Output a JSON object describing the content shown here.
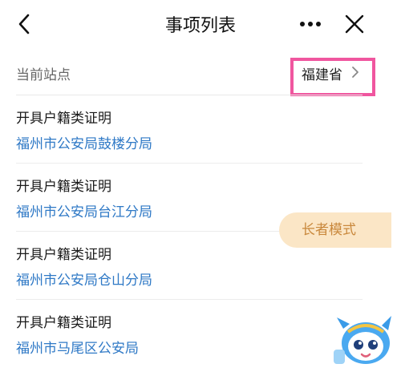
{
  "header": {
    "title": "事项列表"
  },
  "station": {
    "label": "当前站点",
    "value": "福建省"
  },
  "items": [
    {
      "title": "开具户籍类证明",
      "office": "福州市公安局鼓楼分局"
    },
    {
      "title": "开具户籍类证明",
      "office": "福州市公安局台江分局"
    },
    {
      "title": "开具户籍类证明",
      "office": "福州市公安局仓山分局"
    },
    {
      "title": "开具户籍类证明",
      "office": "福州市马尾区公安局"
    }
  ],
  "elder_mode": {
    "label": "长者模式"
  },
  "colors": {
    "link": "#2f79c6",
    "highlight": "#f0569f",
    "elder_bg": "#fbe6c6",
    "elder_text": "#c9883c"
  },
  "icons": [
    "back-icon",
    "more-icon",
    "close-icon",
    "chevron-right-icon",
    "mascot-icon"
  ]
}
